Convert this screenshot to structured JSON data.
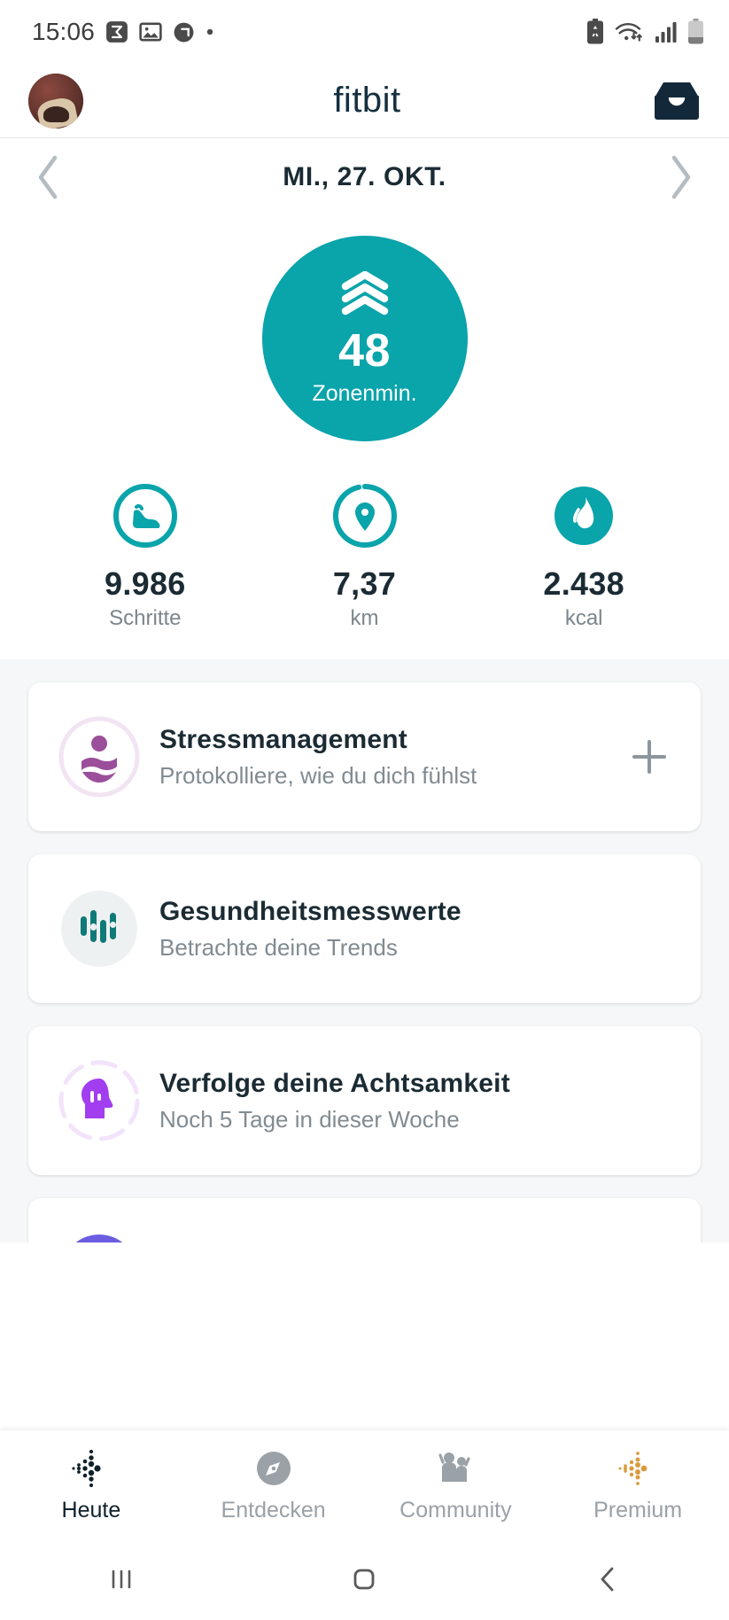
{
  "statusbar": {
    "time": "15:06",
    "left_icons": [
      "sigma-notification-icon",
      "image-notification-icon",
      "circle-notification-icon",
      "dot-indicator-icon"
    ],
    "right_icons": [
      "battery-saver-icon",
      "wifi-icon",
      "signal-bars-icon",
      "battery-icon"
    ]
  },
  "header": {
    "brand": "fitbit",
    "avatar_label": "profile-avatar",
    "inbox_label": "inbox-icon"
  },
  "datenav": {
    "prev_label": "‹",
    "date": "MI., 27. OKT.",
    "next_label": "›"
  },
  "hero": {
    "value": "48",
    "label": "Zonenmin.",
    "color": "#0aa4ab",
    "icon": "active-zone-chevrons-icon"
  },
  "stats": [
    {
      "icon": "shoe-icon",
      "value": "9.986",
      "label": "Schritte"
    },
    {
      "icon": "location-pin-icon",
      "value": "7,37",
      "label": "km"
    },
    {
      "icon": "flame-icon",
      "value": "2.438",
      "label": "kcal"
    }
  ],
  "cards": [
    {
      "icon": "meditation-figure-icon",
      "title": "Stressmanagement",
      "subtitle": "Protokolliere, wie du dich fühlst",
      "action": "+",
      "accent": "#9b4f9b"
    },
    {
      "icon": "health-metrics-bars-icon",
      "title": "Gesundheitsmesswerte",
      "subtitle": "Betrachte deine Trends",
      "action": "",
      "accent": "#0f7a78"
    },
    {
      "icon": "mindfulness-head-icon",
      "title": "Verfolge deine Achtsamkeit",
      "subtitle": "Noch 5 Tage in dieser Woche",
      "action": "",
      "accent": "#a23df0"
    }
  ],
  "tabs": [
    {
      "label": "Heute",
      "icon": "fitbit-dots-icon",
      "active": true
    },
    {
      "label": "Entdecken",
      "icon": "compass-icon",
      "active": false
    },
    {
      "label": "Community",
      "icon": "people-icon",
      "active": false
    },
    {
      "label": "Premium",
      "icon": "premium-dots-icon",
      "active": false
    }
  ],
  "sysnav": {
    "recents": "recents-button",
    "home": "home-button",
    "back": "back-button"
  }
}
